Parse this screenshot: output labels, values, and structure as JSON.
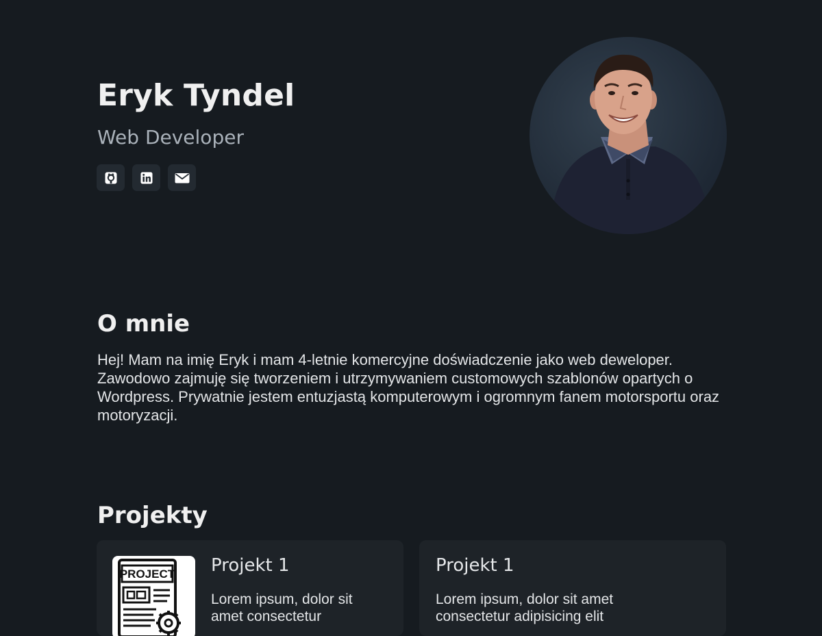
{
  "hero": {
    "name": "Eryk Tyndel",
    "role": "Web Developer",
    "socials": [
      {
        "label": "GitHub",
        "icon": "github-icon"
      },
      {
        "label": "LinkedIn",
        "icon": "linkedin-icon"
      },
      {
        "label": "Email",
        "icon": "mail-icon"
      }
    ],
    "avatar_icon": "profile-photo"
  },
  "about": {
    "title": "O mnie",
    "text": "Hej! Mam na imię Eryk i mam 4-letnie komercyjne doświadczenie jako web deweloper. Zawodowo zajmuję się tworzeniem i utrzymywaniem customowych szablonów opartych o Wordpress. Prywatnie jestem entuzjastą komputerowym i ogromnym fanem motorsportu oraz motoryzacji."
  },
  "projects": {
    "title": "Projekty",
    "items": [
      {
        "name": "Projekt 1",
        "description": "Lorem ipsum, dolor sit amet consectetur",
        "thumb_label": "PROJECT",
        "thumb_icon": "project-document-icon"
      },
      {
        "name": "Projekt 1",
        "description": "Lorem ipsum, dolor sit amet consectetur adipisicing elit"
      }
    ]
  },
  "colors": {
    "background": "#161b20",
    "card": "#1e2328",
    "icon_button": "#232a31",
    "muted_text": "#aab2ba"
  }
}
